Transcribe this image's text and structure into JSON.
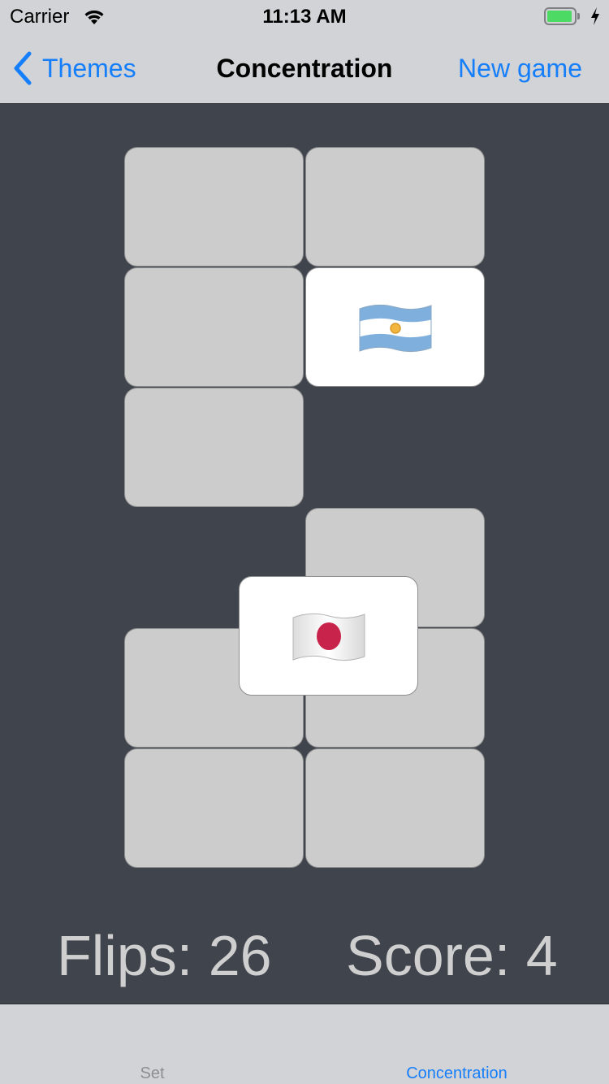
{
  "status_bar": {
    "carrier": "Carrier",
    "time": "11:13 AM",
    "battery_state": "charging",
    "battery_color": "#4cd964"
  },
  "nav_bar": {
    "back_label": "Themes",
    "title": "Concentration",
    "right_button_label": "New game",
    "accent_color": "#157efb"
  },
  "board": {
    "cards": [
      {
        "state": "face-down",
        "emoji": ""
      },
      {
        "state": "face-down",
        "emoji": ""
      },
      {
        "state": "face-down",
        "emoji": ""
      },
      {
        "state": "face-up",
        "emoji": "🇦🇷",
        "flag": "argentina"
      },
      {
        "state": "face-down",
        "emoji": ""
      },
      {
        "state": "face-down",
        "emoji": ""
      },
      {
        "state": "face-down",
        "emoji": ""
      },
      {
        "state": "face-down",
        "emoji": ""
      },
      {
        "state": "face-down",
        "emoji": ""
      },
      {
        "state": "face-down",
        "emoji": ""
      },
      {
        "state": "face-up",
        "emoji": "🇯🇵",
        "flag": "japan"
      }
    ]
  },
  "stats": {
    "flips_label": "Flips: 26",
    "flips": 26,
    "score_label": "Score: 4",
    "score": 4
  },
  "tab_bar": {
    "tabs": [
      {
        "label": "Set",
        "selected": false
      },
      {
        "label": "Concentration",
        "selected": true
      }
    ]
  }
}
